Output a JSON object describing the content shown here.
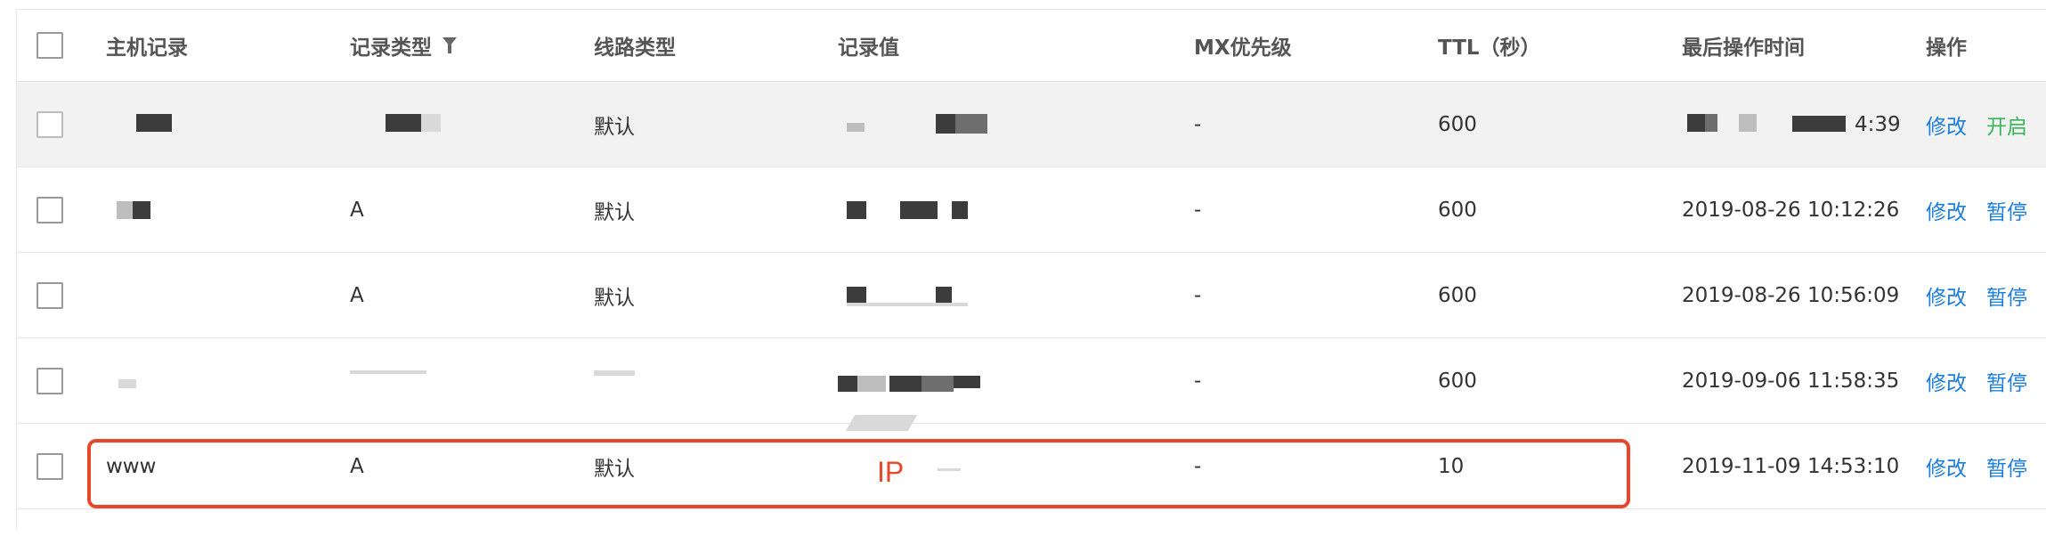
{
  "header": {
    "host": "主机记录",
    "type": "记录类型",
    "line": "线路类型",
    "value": "记录值",
    "mx": "MX优先级",
    "ttl": "TTL（秒）",
    "time": "最后操作时间",
    "ops": "操作"
  },
  "rows": [
    {
      "host": "",
      "type": "",
      "line": "默认",
      "value": "",
      "mx": "-",
      "ttl": "600",
      "time": "4:39",
      "edit": "修改",
      "toggle": "开启",
      "paused": true
    },
    {
      "host": "",
      "type": "A",
      "line": "默认",
      "value": "",
      "mx": "-",
      "ttl": "600",
      "time": "2019-08-26 10:12:26",
      "edit": "修改",
      "toggle": "暂停",
      "paused": false
    },
    {
      "host": "",
      "type": "A",
      "line": "默认",
      "value": "",
      "mx": "-",
      "ttl": "600",
      "time": "2019-08-26 10:56:09",
      "edit": "修改",
      "toggle": "暂停",
      "paused": false
    },
    {
      "host": "",
      "type": "",
      "line": "",
      "value": "",
      "mx": "-",
      "ttl": "600",
      "time": "2019-09-06 11:58:35",
      "edit": "修改",
      "toggle": "暂停",
      "paused": false
    },
    {
      "host": "www",
      "type": "A",
      "line": "默认",
      "value": "",
      "mx": "-",
      "ttl": "10",
      "time": "2019-11-09 14:53:10",
      "edit": "修改",
      "toggle": "暂停",
      "paused": false
    }
  ],
  "annotation": {
    "label": "IP",
    "color": "#e8472a"
  },
  "colors": {
    "link": "#1a7ee0",
    "enable": "#3ab65a",
    "paused_row_bg": "#f2f2f2"
  },
  "icons": {
    "filter": "filter-icon"
  }
}
